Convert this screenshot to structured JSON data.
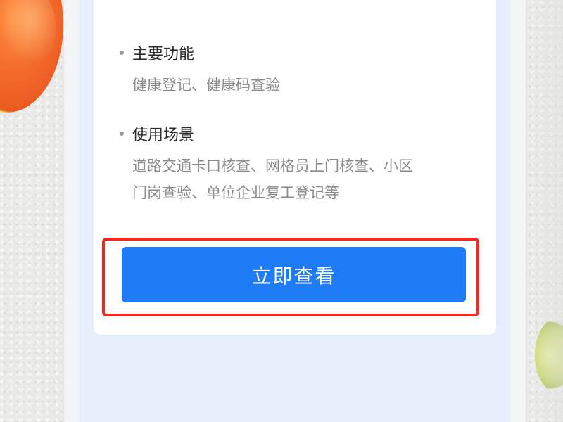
{
  "card": {
    "features": {
      "title": "主要功能",
      "desc": "健康登记、健康码查验"
    },
    "scenarios": {
      "title": "使用场景",
      "desc_line1": "道路交通卡口核查、网格员上门核查、小区",
      "desc_line2": "门岗查验、单位企业复工登记等"
    },
    "view_button_label": "立即查看"
  },
  "colors": {
    "primary_button": "#1e7cf6",
    "highlight_border": "#f02a22",
    "page_background": "#e7effc"
  }
}
